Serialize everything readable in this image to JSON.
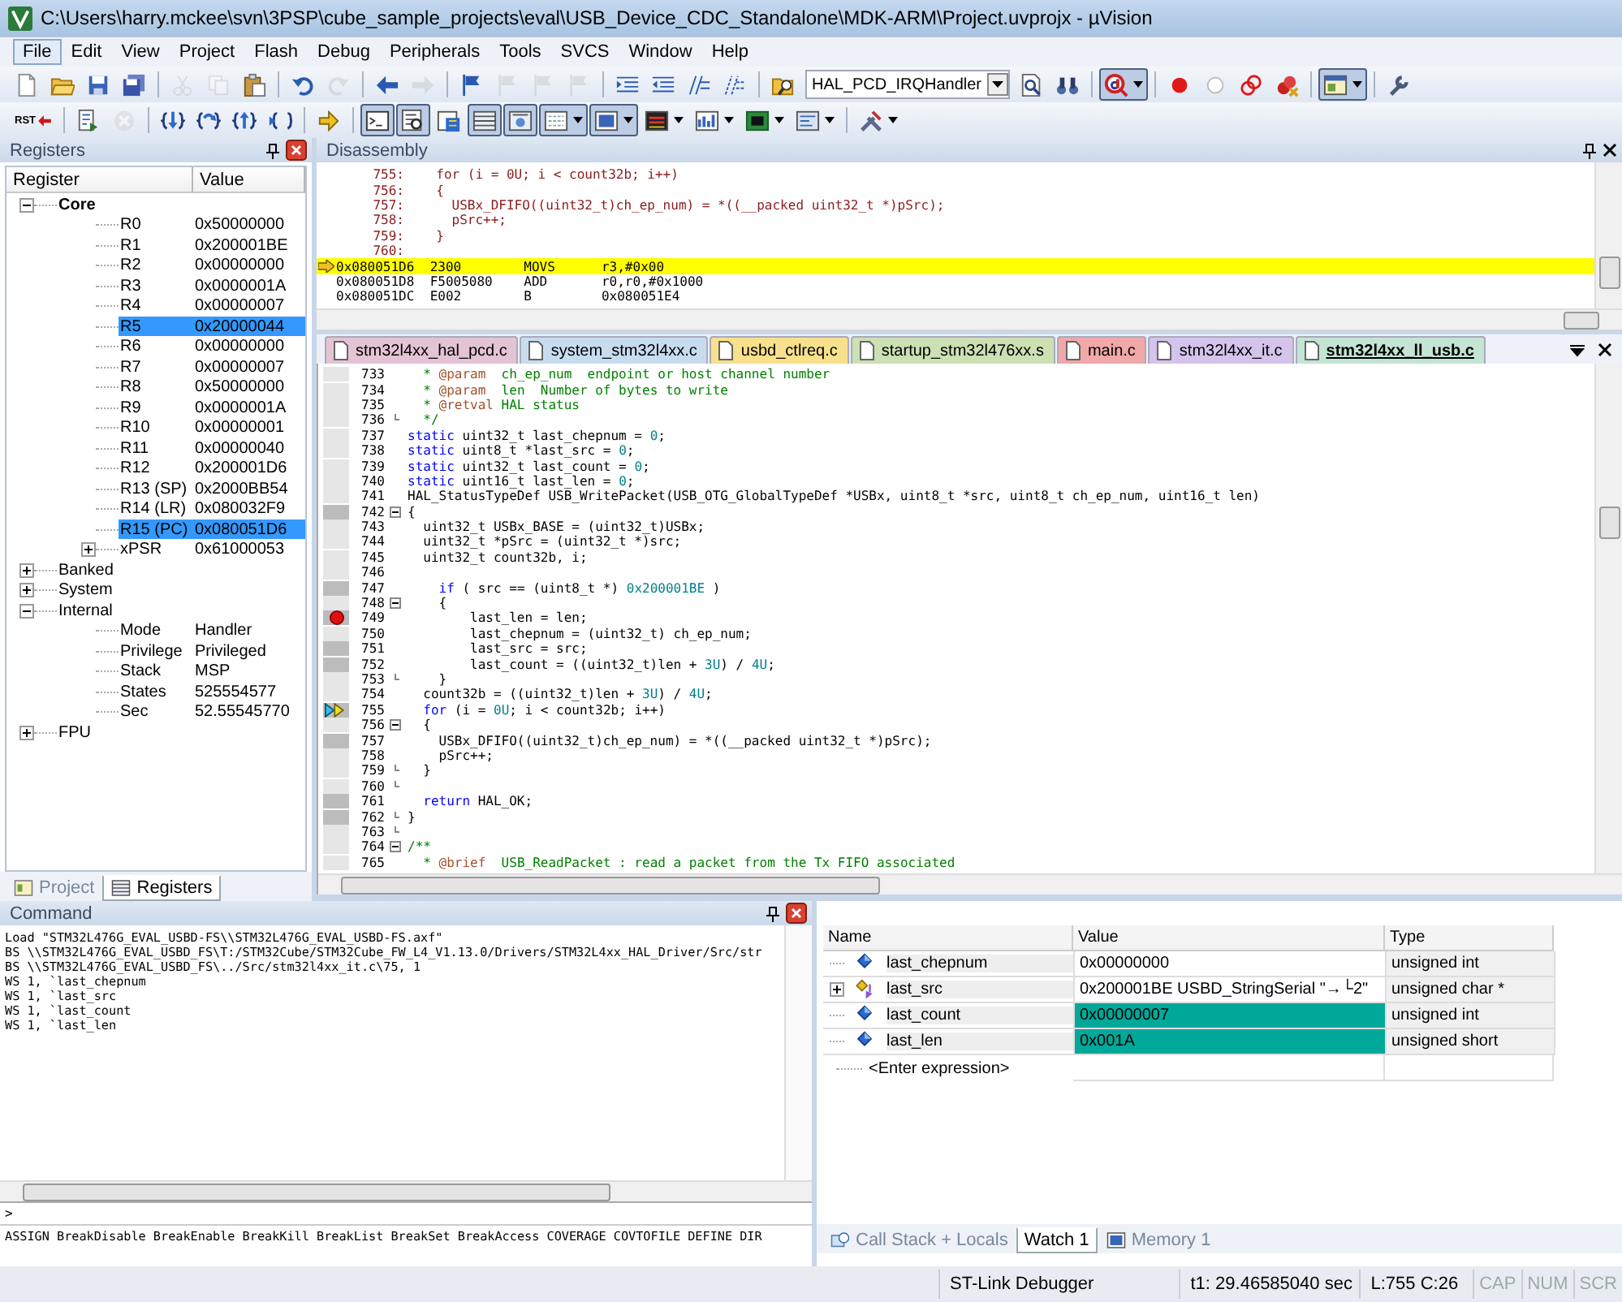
{
  "window": {
    "title": "C:\\Users\\harry.mckee\\svn\\3PSP\\cube_sample_projects\\eval\\USB_Device_CDC_Standalone\\MDK-ARM\\Project.uvprojx - µVision"
  },
  "menu": [
    {
      "label": "File",
      "selected": true
    },
    {
      "label": "Edit",
      "selected": false
    },
    {
      "label": "View",
      "selected": false
    },
    {
      "label": "Project",
      "selected": false
    },
    {
      "label": "Flash",
      "selected": false
    },
    {
      "label": "Debug",
      "selected": false
    },
    {
      "label": "Peripherals",
      "selected": false
    },
    {
      "label": "Tools",
      "selected": false
    },
    {
      "label": "SVCS",
      "selected": false
    },
    {
      "label": "Window",
      "selected": false
    },
    {
      "label": "Help",
      "selected": false
    }
  ],
  "toolbar_1": [
    [
      {
        "kind": "new",
        "disabled": false,
        "pressed": false,
        "dropdown": false
      },
      {
        "kind": "open",
        "disabled": false,
        "pressed": false,
        "dropdown": false
      },
      {
        "kind": "save",
        "disabled": false,
        "pressed": false,
        "dropdown": false
      },
      {
        "kind": "save-all",
        "disabled": false,
        "pressed": false,
        "dropdown": false
      }
    ],
    [
      {
        "kind": "cut",
        "disabled": true,
        "pressed": false,
        "dropdown": false
      },
      {
        "kind": "copy",
        "disabled": true,
        "pressed": false,
        "dropdown": false
      },
      {
        "kind": "paste",
        "disabled": false,
        "pressed": false,
        "dropdown": false
      }
    ],
    [
      {
        "kind": "undo",
        "disabled": false,
        "pressed": false,
        "dropdown": false
      },
      {
        "kind": "redo",
        "disabled": true,
        "pressed": false,
        "dropdown": false
      }
    ],
    [
      {
        "kind": "back",
        "disabled": false,
        "pressed": false,
        "dropdown": false
      },
      {
        "kind": "forward",
        "disabled": true,
        "pressed": false,
        "dropdown": false
      }
    ],
    [
      {
        "kind": "bookmark",
        "disabled": false,
        "pressed": false,
        "dropdown": false
      },
      {
        "kind": "bookmark",
        "disabled": true,
        "pressed": false,
        "dropdown": false
      },
      {
        "kind": "bookmark",
        "disabled": true,
        "pressed": false,
        "dropdown": false
      },
      {
        "kind": "bookmark",
        "disabled": true,
        "pressed": false,
        "dropdown": false
      }
    ],
    [
      {
        "kind": "indent",
        "disabled": false,
        "pressed": false,
        "dropdown": false
      },
      {
        "kind": "unindent",
        "disabled": false,
        "pressed": false,
        "dropdown": false
      },
      {
        "kind": "comment",
        "disabled": false,
        "pressed": false,
        "dropdown": false
      },
      {
        "kind": "uncomment",
        "disabled": false,
        "pressed": false,
        "dropdown": false
      }
    ],
    [
      {
        "kind": "find-in-files",
        "disabled": false,
        "pressed": false,
        "dropdown": false
      },
      {
        "kind": "combo",
        "value": "HAL_PCD_IRQHandler",
        "dropdown": true
      },
      {
        "kind": "find",
        "disabled": false,
        "pressed": false,
        "dropdown": false
      },
      {
        "kind": "incremental-find",
        "disabled": false,
        "pressed": false,
        "dropdown": false
      }
    ],
    [
      {
        "kind": "debug",
        "disabled": false,
        "pressed": true,
        "dropdown": true
      }
    ],
    [
      {
        "kind": "breakpoint",
        "disabled": false,
        "pressed": false,
        "dropdown": false
      },
      {
        "kind": "breakpoint-off",
        "disabled": false,
        "pressed": false,
        "dropdown": false
      },
      {
        "kind": "breakpoint-disable-all",
        "disabled": false,
        "pressed": false,
        "dropdown": false
      },
      {
        "kind": "breakpoint-kill-all",
        "disabled": false,
        "pressed": false,
        "dropdown": false
      }
    ],
    [
      {
        "kind": "window",
        "disabled": false,
        "pressed": true,
        "dropdown": true
      }
    ],
    [
      {
        "kind": "configure",
        "disabled": false,
        "pressed": false,
        "dropdown": false
      }
    ]
  ],
  "toolbar_2": [
    [
      {
        "kind": "reset",
        "label": "RST",
        "disabled": false,
        "pressed": false,
        "dropdown": false
      }
    ],
    [
      {
        "kind": "run",
        "disabled": false,
        "pressed": false,
        "dropdown": false
      },
      {
        "kind": "stop",
        "disabled": true,
        "pressed": false,
        "dropdown": false
      }
    ],
    [
      {
        "kind": "step-into",
        "disabled": false,
        "pressed": false,
        "dropdown": false
      },
      {
        "kind": "step-over",
        "disabled": false,
        "pressed": false,
        "dropdown": false
      },
      {
        "kind": "step-out",
        "disabled": false,
        "pressed": false,
        "dropdown": false
      },
      {
        "kind": "run-to-cursor",
        "disabled": false,
        "pressed": false,
        "dropdown": false
      }
    ],
    [
      {
        "kind": "next-statement",
        "disabled": false,
        "pressed": false,
        "dropdown": false
      }
    ],
    [
      {
        "kind": "command-window",
        "disabled": false,
        "pressed": true,
        "dropdown": false
      },
      {
        "kind": "disassembly-window",
        "disabled": false,
        "pressed": true,
        "dropdown": false
      },
      {
        "kind": "symbols-window",
        "disabled": false,
        "pressed": false,
        "dropdown": false
      },
      {
        "kind": "registers-window",
        "disabled": false,
        "pressed": true,
        "dropdown": false
      },
      {
        "kind": "call-stack-window",
        "disabled": false,
        "pressed": true,
        "dropdown": false
      },
      {
        "kind": "watch-window",
        "disabled": false,
        "pressed": true,
        "dropdown": true
      },
      {
        "kind": "memory-window",
        "disabled": false,
        "pressed": true,
        "dropdown": true
      },
      {
        "kind": "serial-window",
        "disabled": false,
        "pressed": false,
        "dropdown": true
      },
      {
        "kind": "analysis-window",
        "disabled": false,
        "pressed": false,
        "dropdown": true
      },
      {
        "kind": "trace-window",
        "disabled": false,
        "pressed": false,
        "dropdown": true
      },
      {
        "kind": "system-viewer",
        "disabled": false,
        "pressed": false,
        "dropdown": true
      }
    ],
    [
      {
        "kind": "toolbox",
        "disabled": false,
        "pressed": false,
        "dropdown": true
      }
    ]
  ],
  "registers": {
    "title": "Registers",
    "columns": [
      "Register",
      "Value"
    ],
    "tree": [
      {
        "name": "Core",
        "expanded": true,
        "selected": false,
        "children": [
          {
            "name": "R0",
            "value": "0x50000000",
            "selected": false
          },
          {
            "name": "R1",
            "value": "0x200001BE",
            "selected": false
          },
          {
            "name": "R2",
            "value": "0x00000000",
            "selected": false
          },
          {
            "name": "R3",
            "value": "0x0000001A",
            "selected": false
          },
          {
            "name": "R4",
            "value": "0x00000007",
            "selected": false
          },
          {
            "name": "R5",
            "value": "0x20000044",
            "selected": true
          },
          {
            "name": "R6",
            "value": "0x00000000",
            "selected": false
          },
          {
            "name": "R7",
            "value": "0x00000007",
            "selected": false
          },
          {
            "name": "R8",
            "value": "0x50000000",
            "selected": false
          },
          {
            "name": "R9",
            "value": "0x0000001A",
            "selected": false
          },
          {
            "name": "R10",
            "value": "0x00000001",
            "selected": false
          },
          {
            "name": "R11",
            "value": "0x00000040",
            "selected": false
          },
          {
            "name": "R12",
            "value": "0x200001D6",
            "selected": false
          },
          {
            "name": "R13 (SP)",
            "value": "0x2000BB54",
            "selected": false
          },
          {
            "name": "R14 (LR)",
            "value": "0x080032F9",
            "selected": false
          },
          {
            "name": "R15 (PC)",
            "value": "0x080051D6",
            "selected": true
          },
          {
            "name": "xPSR",
            "value": "0x61000053",
            "expanded": false,
            "selected": false
          }
        ]
      },
      {
        "name": "Banked",
        "expanded": false,
        "selected": false
      },
      {
        "name": "System",
        "expanded": false,
        "selected": false
      },
      {
        "name": "Internal",
        "expanded": true,
        "selected": false,
        "children": [
          {
            "name": "Mode",
            "value": "Handler",
            "selected": false
          },
          {
            "name": "Privilege",
            "value": "Privileged",
            "selected": false
          },
          {
            "name": "Stack",
            "value": "MSP",
            "selected": false
          },
          {
            "name": "States",
            "value": "525554577",
            "selected": false
          },
          {
            "name": "Sec",
            "value": "52.55545770",
            "selected": false
          }
        ]
      },
      {
        "name": "FPU",
        "expanded": false,
        "selected": false
      }
    ],
    "tabs": [
      {
        "label": "Project",
        "selected": false,
        "kind": "project"
      },
      {
        "label": "Registers",
        "selected": true,
        "kind": "registers"
      }
    ]
  },
  "disassembly": {
    "title": "Disassembly",
    "lines": [
      {
        "kind": "source",
        "number": "755:",
        "text": "  for (i = 0U; i < count32b; i++)",
        "current": false
      },
      {
        "kind": "source",
        "number": "756:",
        "text": "  {",
        "current": false
      },
      {
        "kind": "source",
        "number": "757:",
        "text": "    USBx_DFIFO((uint32_t)ch_ep_num) = *((__packed uint32_t *)pSrc);",
        "current": false
      },
      {
        "kind": "source",
        "number": "758:",
        "text": "    pSrc++;",
        "current": false
      },
      {
        "kind": "source",
        "number": "759:",
        "text": "  }",
        "current": false
      },
      {
        "kind": "source",
        "number": "760:",
        "current": false
      },
      {
        "kind": "asm",
        "address": "0x080051D6",
        "opcode": "2300",
        "mnemonic": "MOVS",
        "operands": "r3,#0x00",
        "current": true
      },
      {
        "kind": "asm",
        "address": "0x080051D8",
        "opcode": "F5005080",
        "mnemonic": "ADD",
        "operands": "r0,r0,#0x1000",
        "current": false
      },
      {
        "kind": "asm",
        "address": "0x080051DC",
        "opcode": "E002",
        "mnemonic": "B",
        "operands": "0x080051E4",
        "current": false
      }
    ]
  },
  "editor_tabs": [
    {
      "label": "stm32l4xx_hal_pcd.c",
      "color": "#e4c4d4",
      "selected": false
    },
    {
      "label": "system_stm32l4xx.c",
      "color": "#c8dcf0",
      "selected": false
    },
    {
      "label": "usbd_ctlreq.c",
      "color": "#f8e08c",
      "selected": false
    },
    {
      "label": "startup_stm32l476xx.s",
      "color": "#cce0b4",
      "selected": false
    },
    {
      "label": "main.c",
      "color": "#f0a8a8",
      "selected": false
    },
    {
      "label": "stm32l4xx_it.c",
      "color": "#d4c4ec",
      "selected": false
    },
    {
      "label": "stm32l4xx_ll_usb.c",
      "color": "#c4e4d4",
      "selected": true
    }
  ],
  "code": {
    "lines": [
      {
        "number": "733",
        "executable": false,
        "breakpoint": false,
        "current": false,
        "fold_open": false,
        "fold_end": false,
        "segments": [
          {
            "kind": "comment",
            "text": "  * "
          },
          {
            "kind": "tag",
            "text": "@param"
          },
          {
            "kind": "comment",
            "text": "  ch_ep_num  endpoint or host channel number"
          }
        ]
      },
      {
        "number": "734",
        "executable": false,
        "breakpoint": false,
        "current": false,
        "fold_open": false,
        "fold_end": false,
        "segments": [
          {
            "kind": "comment",
            "text": "  * "
          },
          {
            "kind": "tag",
            "text": "@param"
          },
          {
            "kind": "comment",
            "text": "  len  Number of bytes to write"
          }
        ]
      },
      {
        "number": "735",
        "executable": false,
        "breakpoint": false,
        "current": false,
        "fold_open": false,
        "fold_end": false,
        "segments": [
          {
            "kind": "comment",
            "text": "  * "
          },
          {
            "kind": "tag",
            "text": "@retval"
          },
          {
            "kind": "comment",
            "text": " HAL status"
          }
        ]
      },
      {
        "number": "736",
        "executable": false,
        "breakpoint": false,
        "current": false,
        "fold_open": false,
        "fold_end": true,
        "segments": [
          {
            "kind": "comment",
            "text": "  */"
          }
        ]
      },
      {
        "number": "737",
        "executable": false,
        "breakpoint": false,
        "current": false,
        "fold_open": false,
        "fold_end": false,
        "segments": [
          {
            "kind": "keyword",
            "text": "static"
          },
          {
            "kind": "plain",
            "text": " uint32_t last_chepnum = "
          },
          {
            "kind": "number",
            "text": "0"
          },
          {
            "kind": "plain",
            "text": ";"
          }
        ]
      },
      {
        "number": "738",
        "executable": false,
        "breakpoint": false,
        "current": false,
        "fold_open": false,
        "fold_end": false,
        "segments": [
          {
            "kind": "keyword",
            "text": "static"
          },
          {
            "kind": "plain",
            "text": " uint8_t *last_src = "
          },
          {
            "kind": "number",
            "text": "0"
          },
          {
            "kind": "plain",
            "text": ";"
          }
        ]
      },
      {
        "number": "739",
        "executable": false,
        "breakpoint": false,
        "current": false,
        "fold_open": false,
        "fold_end": false,
        "segments": [
          {
            "kind": "keyword",
            "text": "static"
          },
          {
            "kind": "plain",
            "text": " uint32_t last_count = "
          },
          {
            "kind": "number",
            "text": "0"
          },
          {
            "kind": "plain",
            "text": ";"
          }
        ]
      },
      {
        "number": "740",
        "executable": false,
        "breakpoint": false,
        "current": false,
        "fold_open": false,
        "fold_end": false,
        "segments": [
          {
            "kind": "keyword",
            "text": "static"
          },
          {
            "kind": "plain",
            "text": " uint16_t last_len = "
          },
          {
            "kind": "number",
            "text": "0"
          },
          {
            "kind": "plain",
            "text": ";"
          }
        ]
      },
      {
        "number": "741",
        "executable": false,
        "breakpoint": false,
        "current": false,
        "fold_open": false,
        "fold_end": false,
        "segments": [
          {
            "kind": "plain",
            "text": "HAL_StatusTypeDef USB_WritePacket(USB_OTG_GlobalTypeDef *USBx, uint8_t *src, uint8_t ch_ep_num, uint16_t len)"
          }
        ]
      },
      {
        "number": "742",
        "executable": true,
        "breakpoint": false,
        "current": false,
        "fold_open": true,
        "fold_end": false,
        "segments": [
          {
            "kind": "plain",
            "text": "{"
          }
        ]
      },
      {
        "number": "743",
        "executable": false,
        "breakpoint": false,
        "current": false,
        "fold_open": false,
        "fold_end": false,
        "segments": [
          {
            "kind": "plain",
            "text": "  uint32_t USBx_BASE = (uint32_t)USBx;"
          }
        ]
      },
      {
        "number": "744",
        "executable": false,
        "breakpoint": false,
        "current": false,
        "fold_open": false,
        "fold_end": false,
        "segments": [
          {
            "kind": "plain",
            "text": "  uint32_t *pSrc = (uint32_t *)src;"
          }
        ]
      },
      {
        "number": "745",
        "executable": false,
        "breakpoint": false,
        "current": false,
        "fold_open": false,
        "fold_end": false,
        "segments": [
          {
            "kind": "plain",
            "text": "  uint32_t count32b, i;"
          }
        ]
      },
      {
        "number": "746",
        "executable": false,
        "breakpoint": false,
        "current": false,
        "fold_open": false,
        "fold_end": false
      },
      {
        "number": "747",
        "executable": true,
        "breakpoint": false,
        "current": false,
        "fold_open": false,
        "fold_end": false,
        "segments": [
          {
            "kind": "keyword",
            "text": "    if"
          },
          {
            "kind": "plain",
            "text": " ( src == (uint8_t *) "
          },
          {
            "kind": "number",
            "text": "0x200001BE"
          },
          {
            "kind": "plain",
            "text": " )"
          }
        ]
      },
      {
        "number": "748",
        "executable": false,
        "breakpoint": false,
        "current": false,
        "fold_open": true,
        "fold_end": false,
        "segments": [
          {
            "kind": "plain",
            "text": "    {"
          }
        ]
      },
      {
        "number": "749",
        "executable": true,
        "breakpoint": true,
        "current": false,
        "fold_open": false,
        "fold_end": false,
        "segments": [
          {
            "kind": "plain",
            "text": "        last_len = len;"
          }
        ]
      },
      {
        "number": "750",
        "executable": false,
        "breakpoint": false,
        "current": false,
        "fold_open": false,
        "fold_end": false,
        "segments": [
          {
            "kind": "plain",
            "text": "        last_chepnum = (uint32_t) ch_ep_num;"
          }
        ]
      },
      {
        "number": "751",
        "executable": true,
        "breakpoint": false,
        "current": false,
        "fold_open": false,
        "fold_end": false,
        "segments": [
          {
            "kind": "plain",
            "text": "        last_src = src;"
          }
        ]
      },
      {
        "number": "752",
        "executable": true,
        "breakpoint": false,
        "current": false,
        "fold_open": false,
        "fold_end": false,
        "segments": [
          {
            "kind": "plain",
            "text": "        last_count = ((uint32_t)len + "
          },
          {
            "kind": "number",
            "text": "3U"
          },
          {
            "kind": "plain",
            "text": ") / "
          },
          {
            "kind": "number",
            "text": "4U"
          },
          {
            "kind": "plain",
            "text": ";"
          }
        ]
      },
      {
        "number": "753",
        "executable": false,
        "breakpoint": false,
        "current": false,
        "fold_open": false,
        "fold_end": true,
        "segments": [
          {
            "kind": "plain",
            "text": "    }"
          }
        ]
      },
      {
        "number": "754",
        "executable": false,
        "breakpoint": false,
        "current": false,
        "fold_open": false,
        "fold_end": false,
        "segments": [
          {
            "kind": "plain",
            "text": "  count32b = ((uint32_t)len + "
          },
          {
            "kind": "number",
            "text": "3U"
          },
          {
            "kind": "plain",
            "text": ") / "
          },
          {
            "kind": "number",
            "text": "4U"
          },
          {
            "kind": "plain",
            "text": ";"
          }
        ]
      },
      {
        "number": "755",
        "executable": true,
        "breakpoint": false,
        "current": true,
        "fold_open": false,
        "fold_end": false,
        "segments": [
          {
            "kind": "keyword",
            "text": "  for"
          },
          {
            "kind": "plain",
            "text": " (i = "
          },
          {
            "kind": "number",
            "text": "0U"
          },
          {
            "kind": "plain",
            "text": "; i < count32b; i++)"
          }
        ]
      },
      {
        "number": "756",
        "executable": false,
        "breakpoint": false,
        "current": false,
        "fold_open": true,
        "fold_end": false,
        "segments": [
          {
            "kind": "plain",
            "text": "  {"
          }
        ]
      },
      {
        "number": "757",
        "executable": true,
        "breakpoint": false,
        "current": false,
        "fold_open": false,
        "fold_end": false,
        "segments": [
          {
            "kind": "plain",
            "text": "    USBx_DFIFO((uint32_t)ch_ep_num) = *((__packed uint32_t *)pSrc);"
          }
        ]
      },
      {
        "number": "758",
        "executable": false,
        "breakpoint": false,
        "current": false,
        "fold_open": false,
        "fold_end": false,
        "segments": [
          {
            "kind": "plain",
            "text": "    pSrc++;"
          }
        ]
      },
      {
        "number": "759",
        "executable": false,
        "breakpoint": false,
        "current": false,
        "fold_open": false,
        "fold_end": true,
        "segments": [
          {
            "kind": "plain",
            "text": "  }"
          }
        ]
      },
      {
        "number": "760",
        "executable": false,
        "breakpoint": false,
        "current": false,
        "fold_open": false,
        "fold_end": true
      },
      {
        "number": "761",
        "executable": true,
        "breakpoint": false,
        "current": false,
        "fold_open": false,
        "fold_end": false,
        "segments": [
          {
            "kind": "keyword",
            "text": "  return"
          },
          {
            "kind": "plain",
            "text": " HAL_OK;"
          }
        ]
      },
      {
        "number": "762",
        "executable": true,
        "breakpoint": false,
        "current": false,
        "fold_open": false,
        "fold_end": true,
        "segments": [
          {
            "kind": "plain",
            "text": "}"
          }
        ]
      },
      {
        "number": "763",
        "executable": false,
        "breakpoint": false,
        "current": false,
        "fold_open": false,
        "fold_end": true
      },
      {
        "number": "764",
        "executable": false,
        "breakpoint": false,
        "current": false,
        "fold_open": true,
        "fold_end": false,
        "segments": [
          {
            "kind": "comment",
            "text": "/**"
          }
        ]
      },
      {
        "number": "765",
        "executable": false,
        "breakpoint": false,
        "current": false,
        "fold_open": false,
        "fold_end": false,
        "segments": [
          {
            "kind": "comment",
            "text": "  * "
          },
          {
            "kind": "tag",
            "text": "@brief"
          },
          {
            "kind": "comment",
            "text": "  USB_ReadPacket : read a packet from the Tx FIFO associated"
          }
        ]
      }
    ]
  },
  "command": {
    "title": "Command",
    "lines": [
      "Load \"STM32L476G_EVAL_USBD-FS\\\\STM32L476G_EVAL_USBD-FS.axf\"",
      "BS \\\\STM32L476G_EVAL_USBD_FS\\T:/STM32Cube/STM32Cube_FW_L4_V1.13.0/Drivers/STM32L4xx_HAL_Driver/Src/str",
      "BS \\\\STM32L476G_EVAL_USBD_FS\\../Src/stm32l4xx_it.c\\75, 1",
      "WS 1, `last_chepnum",
      "WS 1, `last_src",
      "WS 1, `last_count",
      "WS 1, `last_len"
    ],
    "prompt": ">",
    "hint": "ASSIGN BreakDisable BreakEnable BreakKill BreakList BreakSet BreakAccess COVERAGE COVTOFILE DEFINE DIR"
  },
  "watch": {
    "columns": [
      "Name",
      "Value",
      "Type"
    ],
    "rows": [
      {
        "kind": "variable",
        "name": "last_chepnum",
        "value": "0x00000000",
        "type": "unsigned int",
        "changed": false
      },
      {
        "kind": "pointer",
        "name": "last_src",
        "value": "0x200001BE USBD_StringSerial \"→└2\"",
        "type": "unsigned char *",
        "changed": false,
        "expanded": false
      },
      {
        "kind": "variable",
        "name": "last_count",
        "value": "0x00000007",
        "type": "unsigned int",
        "changed": true
      },
      {
        "kind": "variable",
        "name": "last_len",
        "value": "0x001A",
        "type": "unsigned short",
        "changed": true
      }
    ],
    "new_row": "<Enter expression>",
    "tabs": [
      {
        "label": "Call Stack + Locals",
        "selected": false,
        "kind": "call-stack"
      },
      {
        "label": "Watch 1",
        "selected": true,
        "kind": "watch"
      },
      {
        "label": "Memory 1",
        "selected": false,
        "kind": "memory"
      }
    ]
  },
  "status_bar": {
    "debugger": "ST-Link Debugger",
    "time": "t1: 29.46585040 sec",
    "position": "L:755 C:26",
    "indicators": [
      {
        "label": "CAP",
        "on": false
      },
      {
        "label": "NUM",
        "on": false
      },
      {
        "label": "SCR",
        "on": false
      }
    ]
  }
}
